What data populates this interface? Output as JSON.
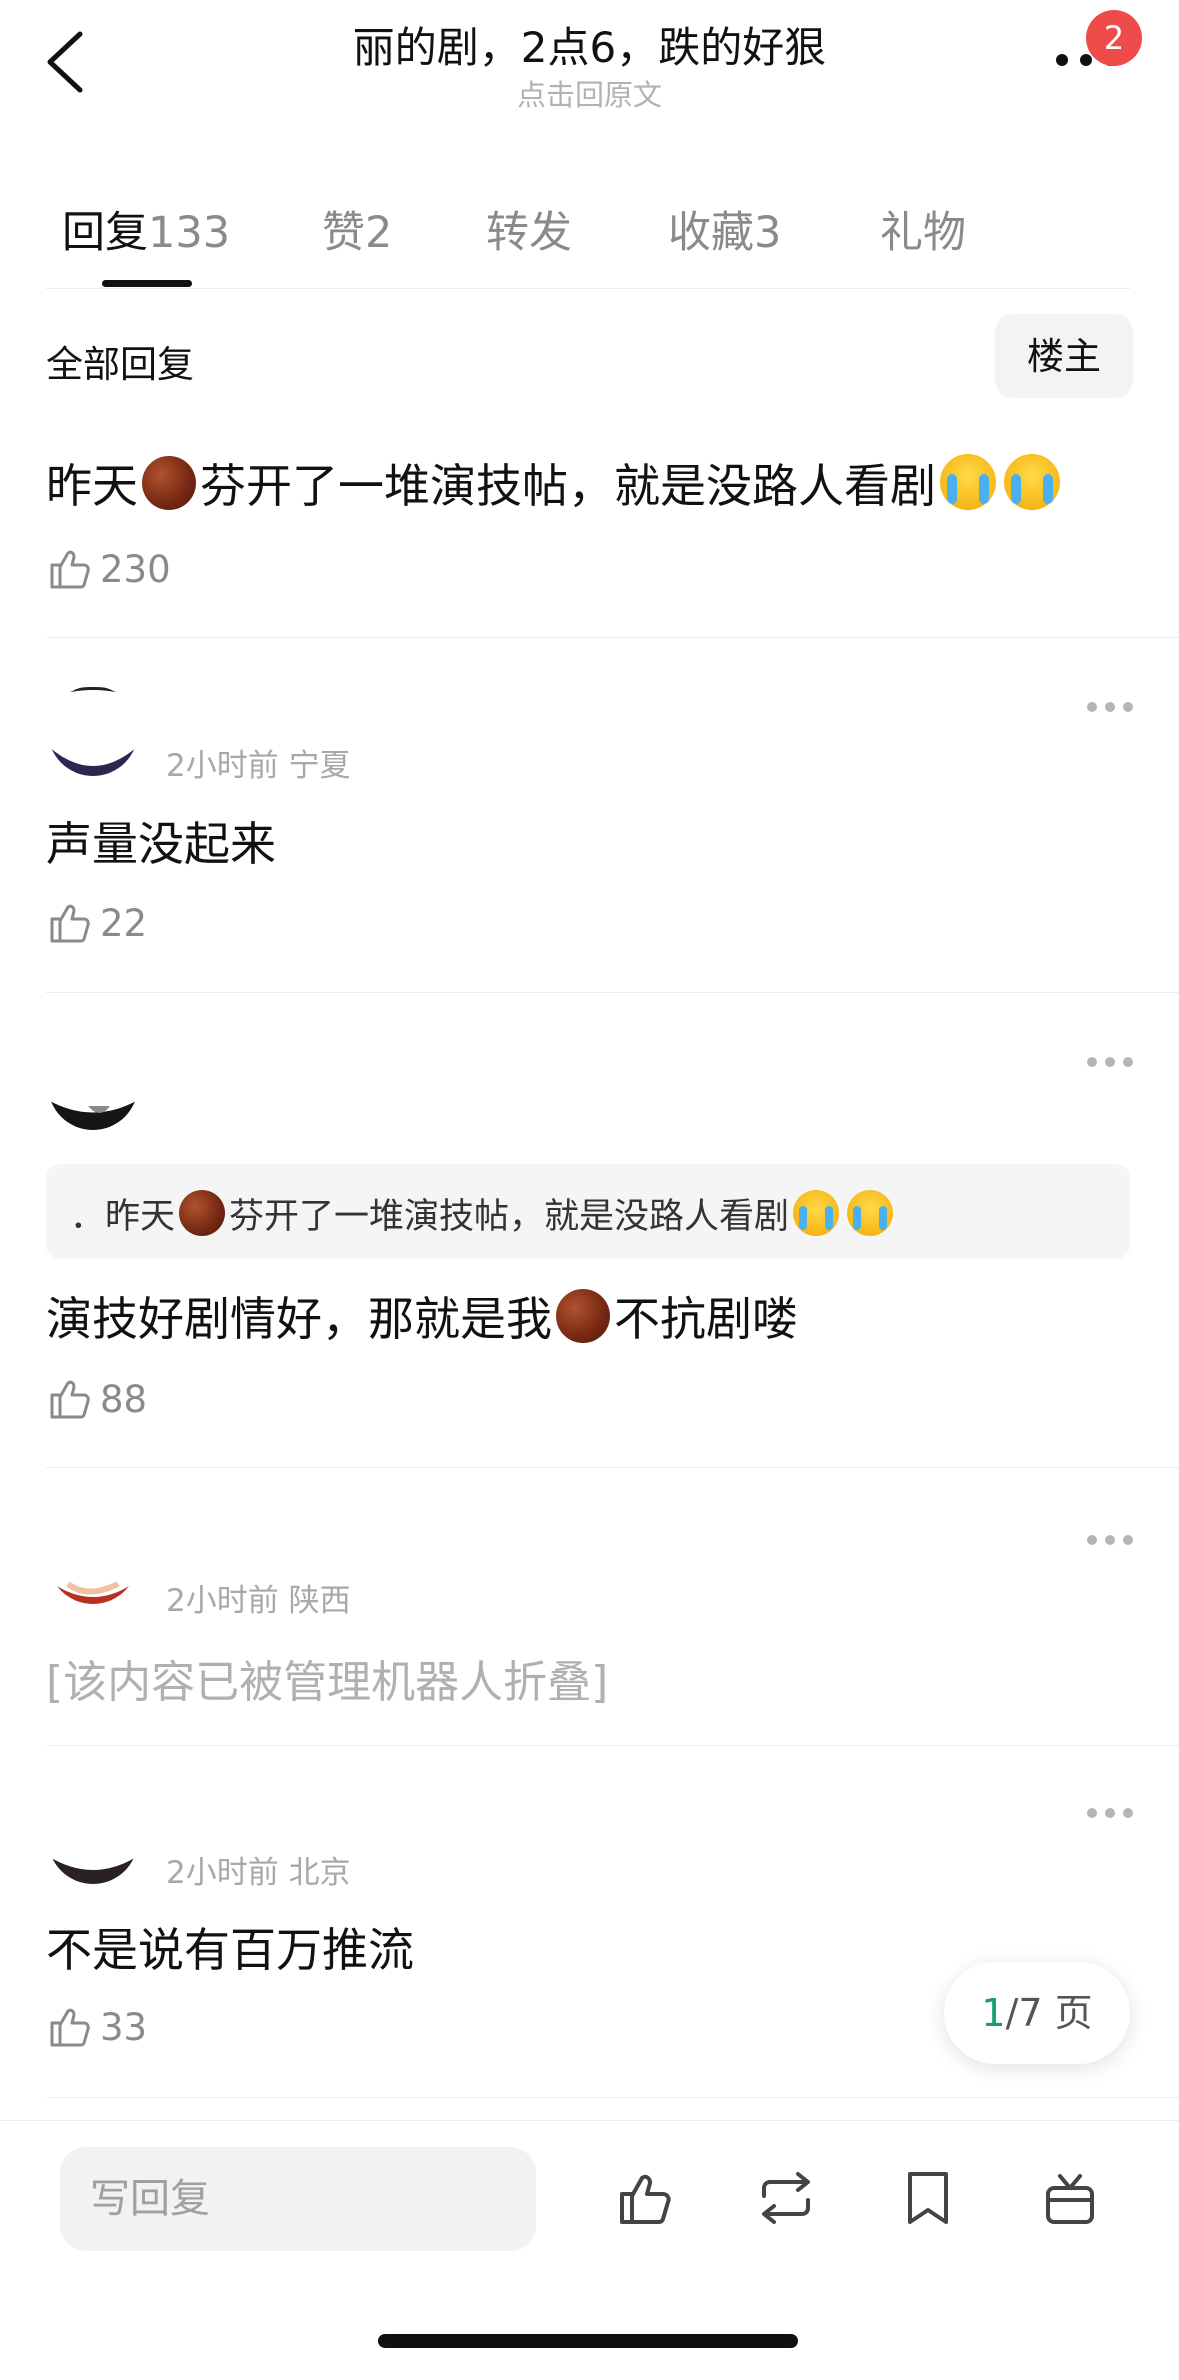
{
  "header": {
    "title": "丽的剧，2点6，跌的好狠",
    "subtitle": "点击回原文",
    "badge": "2"
  },
  "tabs": [
    {
      "label": "回复",
      "count": "133"
    },
    {
      "label": "赞",
      "count": "2"
    },
    {
      "label": "转发",
      "count": ""
    },
    {
      "label": "收藏",
      "count": "3"
    },
    {
      "label": "礼物",
      "count": ""
    }
  ],
  "section": {
    "all_replies": "全部回复",
    "op_filter": "楼主"
  },
  "post": {
    "text_a": "昨天",
    "text_b": "芬开了一堆演技帖，就是没路人看剧",
    "likes": "230"
  },
  "comments": [
    {
      "meta": "2小时前 宁夏",
      "text": "声量没起来",
      "likes": "22"
    },
    {
      "meta": "",
      "quote_a": "．昨天",
      "quote_b": "芬开了一堆演技帖，就是没路人看剧",
      "text_a": "演技好剧情好，那就是我",
      "text_b": "不抗剧喽",
      "likes": "88"
    },
    {
      "meta": "2小时前 陕西",
      "text": "[该内容已被管理机器人折叠]"
    },
    {
      "meta": "2小时前 北京",
      "text": "不是说有百万推流",
      "likes": "33"
    }
  ],
  "pager": {
    "current": "1",
    "total": "/7 页"
  },
  "bottom_bar": {
    "reply_placeholder": "写回复"
  }
}
